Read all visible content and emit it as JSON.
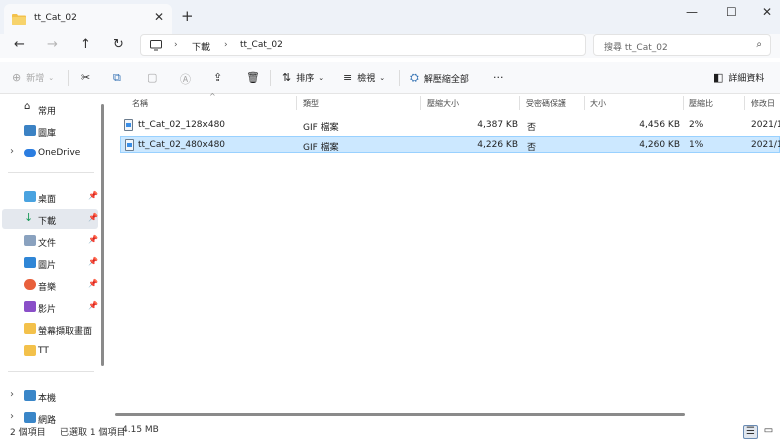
{
  "window": {
    "tab_title": "tt_Cat_02",
    "new_tab": "+",
    "minimize": "—",
    "maximize": "☐",
    "close": "✕"
  },
  "nav": {
    "back": "←",
    "forward": "→",
    "up": "↑",
    "refresh": "↻",
    "breadcrumb": [
      "下載",
      "tt_Cat_02"
    ],
    "search_placeholder": "搜尋 tt_Cat_02"
  },
  "toolbar": {
    "new_label": "新增",
    "sort_label": "排序",
    "view_label": "檢視",
    "extract_label": "解壓縮全部",
    "details_label": "詳細資料",
    "more": "···"
  },
  "sidebar": {
    "items": [
      {
        "label": "常用",
        "pinned": false
      },
      {
        "label": "圖庫",
        "pinned": false
      },
      {
        "label": "OneDrive",
        "pinned": false
      },
      {
        "label": "桌面",
        "pinned": true
      },
      {
        "label": "下載",
        "pinned": true
      },
      {
        "label": "文件",
        "pinned": true
      },
      {
        "label": "圖片",
        "pinned": true
      },
      {
        "label": "音樂",
        "pinned": true
      },
      {
        "label": "影片",
        "pinned": true
      },
      {
        "label": "螢幕擷取畫面",
        "pinned": false
      },
      {
        "label": "TT",
        "pinned": false
      },
      {
        "label": "本機",
        "pinned": false
      },
      {
        "label": "網路",
        "pinned": false
      }
    ]
  },
  "columns": [
    "名稱",
    "類型",
    "壓縮大小",
    "受密碼保護",
    "大小",
    "壓縮比",
    "修改日"
  ],
  "files": [
    {
      "name": "tt_Cat_02_128x480",
      "type": "GIF 檔案",
      "compressed": "4,387 KB",
      "password": "否",
      "size": "4,456 KB",
      "ratio": "2%",
      "modified": "2021/1"
    },
    {
      "name": "tt_Cat_02_480x480",
      "type": "GIF 檔案",
      "compressed": "4,226 KB",
      "password": "否",
      "size": "4,260 KB",
      "ratio": "1%",
      "modified": "2021/1"
    }
  ],
  "status": {
    "count": "2 個項目",
    "selected": "已選取 1 個項目",
    "size": "4.15 MB"
  }
}
